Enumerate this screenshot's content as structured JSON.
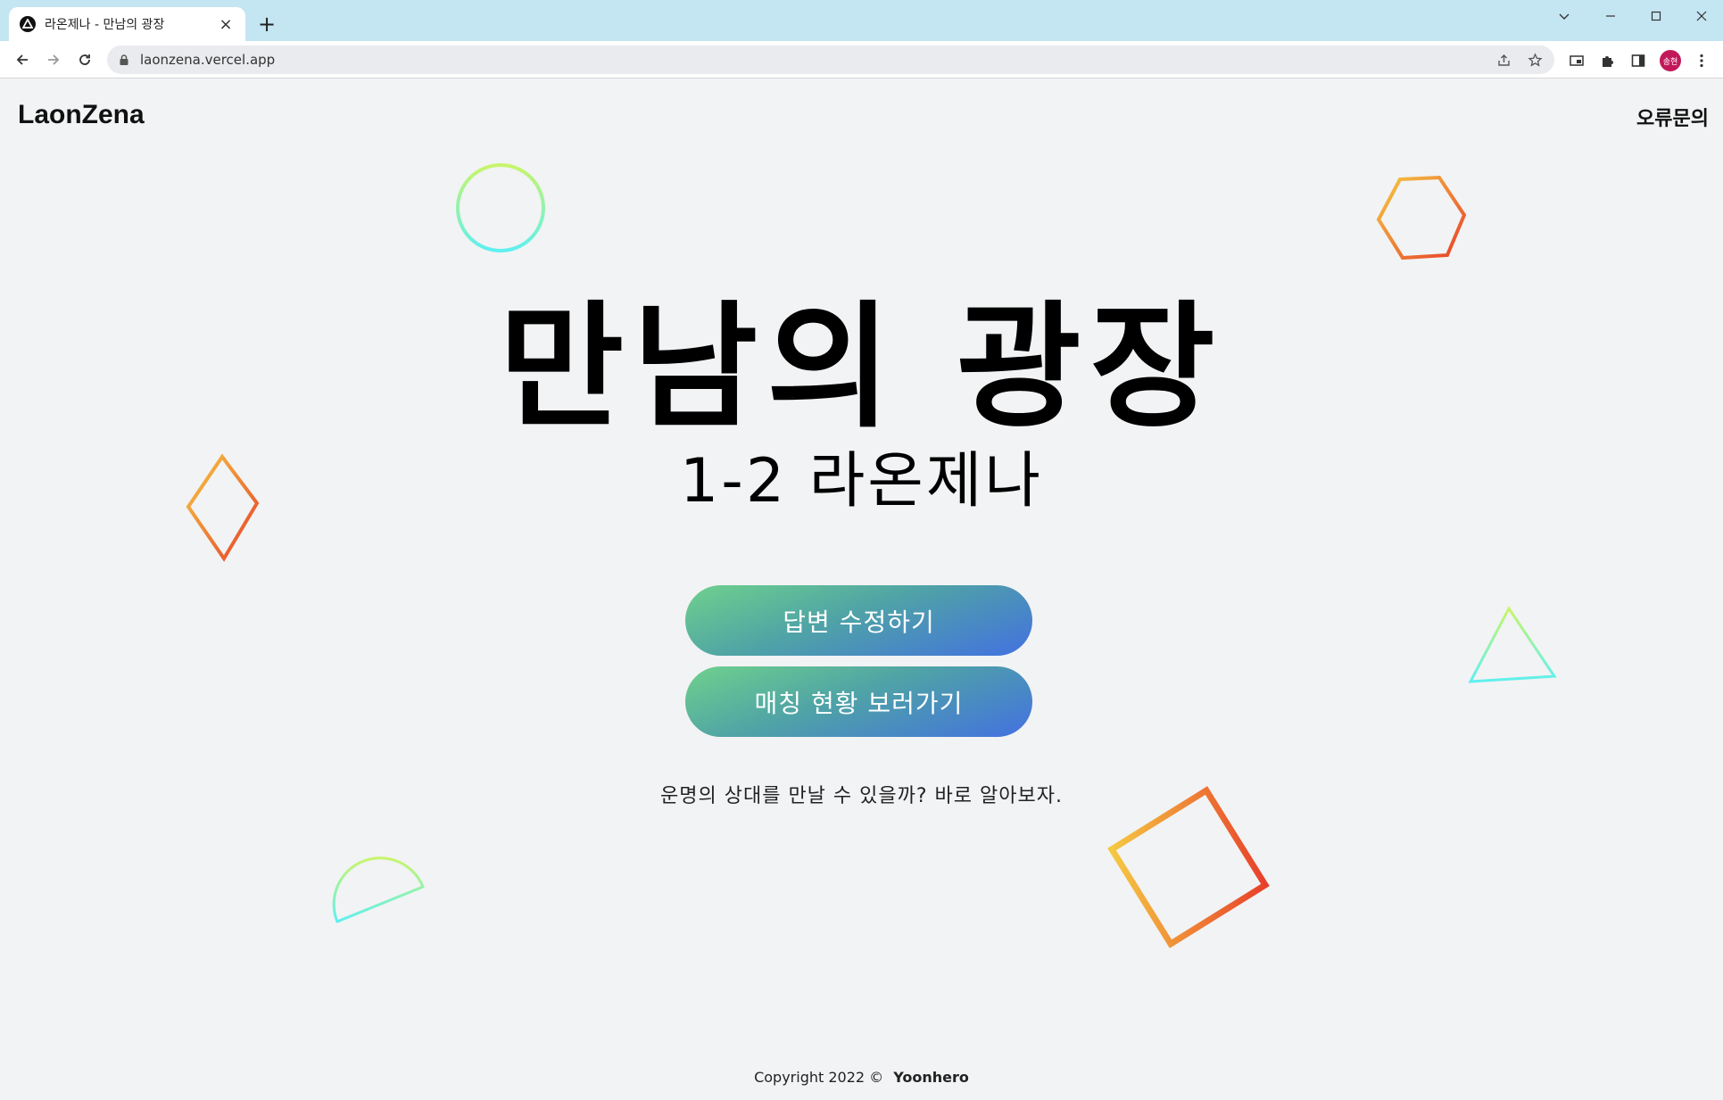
{
  "browser": {
    "tab_title": "라온제나 - 만남의 광장",
    "url": "laonzena.vercel.app",
    "profile_initials": "송현"
  },
  "header": {
    "logo": "LaonZena",
    "report_link": "오류문의"
  },
  "hero": {
    "title": "만남의 광장",
    "subtitle": "1-2 라온제나"
  },
  "buttons": {
    "edit_answer": "답변 수정하기",
    "view_matching": "매칭 현황 보러가기"
  },
  "tagline": "운명의 상대를 만날 수 있을까? 바로 알아보자.",
  "footer": {
    "copyright": "Copyright 2022 ©",
    "author": "Yoonhero"
  },
  "colors": {
    "button_gradient_start": "#6fd18c",
    "button_gradient_end": "#4371e0",
    "warm_shape_start": "#f5c842",
    "warm_shape_end": "#e8402a",
    "cool_shape_start": "#c8f56a",
    "cool_shape_end": "#5ef0f0",
    "background": "#f2f3f4",
    "tabbar": "#c4e5f2"
  }
}
